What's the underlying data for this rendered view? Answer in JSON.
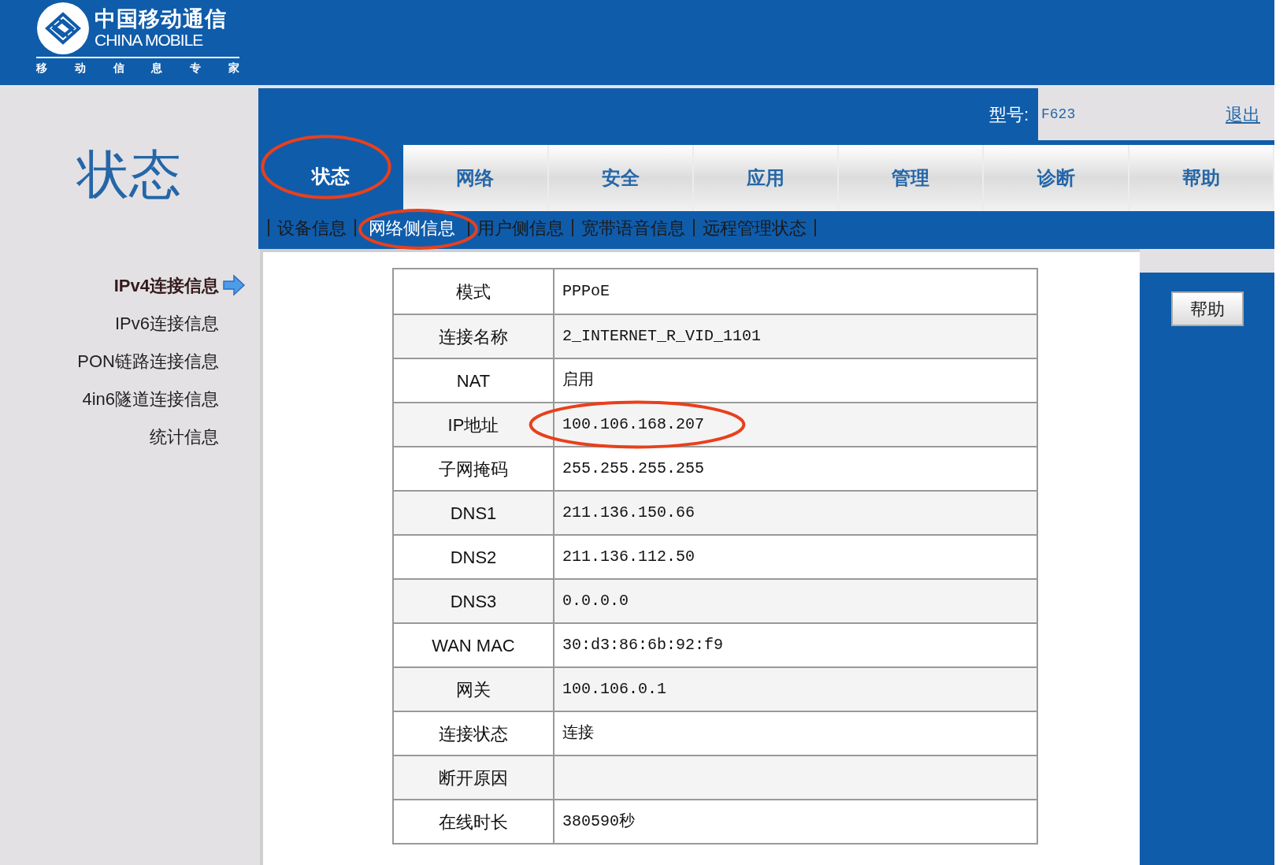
{
  "logo": {
    "name_cn": "中国移动通信",
    "name_en": "CHINA MOBILE",
    "slogan": [
      "移",
      "动",
      "信",
      "息",
      "专",
      "家"
    ]
  },
  "section_title": "状态",
  "model": {
    "label": "型号:",
    "value": "F623"
  },
  "logout": "退出",
  "tabs": [
    {
      "label": "状态",
      "selected": true,
      "circled": true
    },
    {
      "label": "网络",
      "selected": false,
      "circled": false
    },
    {
      "label": "安全",
      "selected": false,
      "circled": false
    },
    {
      "label": "应用",
      "selected": false,
      "circled": false
    },
    {
      "label": "管理",
      "selected": false,
      "circled": false
    },
    {
      "label": "诊断",
      "selected": false,
      "circled": false
    },
    {
      "label": "帮助",
      "selected": false,
      "circled": false
    }
  ],
  "subtabs": [
    {
      "label": "设备信息",
      "selected": false,
      "circled": false
    },
    {
      "label": "网络侧信息",
      "selected": true,
      "circled": true
    },
    {
      "label": "用户侧信息",
      "selected": false,
      "circled": false
    },
    {
      "label": "宽带语音信息",
      "selected": false,
      "circled": false
    },
    {
      "label": "远程管理状态",
      "selected": false,
      "circled": false
    }
  ],
  "sidebar": {
    "items": [
      {
        "label": "IPv4连接信息",
        "selected": true
      },
      {
        "label": "IPv6连接信息",
        "selected": false
      },
      {
        "label": "PON链路连接信息",
        "selected": false
      },
      {
        "label": "4in6隧道连接信息",
        "selected": false
      },
      {
        "label": "统计信息",
        "selected": false
      }
    ]
  },
  "table": {
    "rows": [
      {
        "label": "模式",
        "value": "PPPoE",
        "circled": false
      },
      {
        "label": "连接名称",
        "value": "2_INTERNET_R_VID_1101",
        "circled": false
      },
      {
        "label": "NAT",
        "value": "启用",
        "circled": false
      },
      {
        "label": "IP地址",
        "value": "100.106.168.207",
        "circled": true
      },
      {
        "label": "子网掩码",
        "value": "255.255.255.255",
        "circled": false
      },
      {
        "label": "DNS1",
        "value": "211.136.150.66",
        "circled": false
      },
      {
        "label": "DNS2",
        "value": "211.136.112.50",
        "circled": false
      },
      {
        "label": "DNS3",
        "value": "0.0.0.0",
        "circled": false
      },
      {
        "label": "WAN MAC",
        "value": "30:d3:86:6b:92:f9",
        "circled": false
      },
      {
        "label": "网关",
        "value": "100.106.0.1",
        "circled": false
      },
      {
        "label": "连接状态",
        "value": "连接",
        "circled": false
      },
      {
        "label": "断开原因",
        "value": "",
        "circled": false
      },
      {
        "label": "在线时长",
        "value": "380590秒",
        "circled": false
      }
    ]
  },
  "help_button": "帮助"
}
